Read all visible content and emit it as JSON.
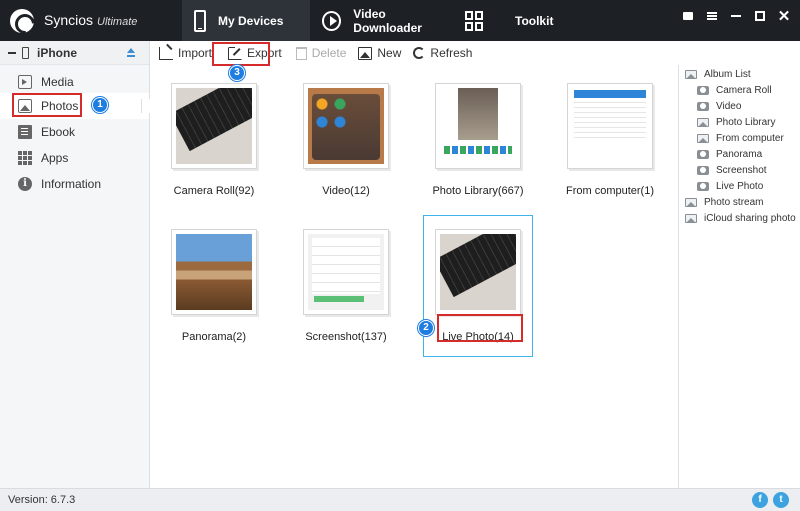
{
  "app": {
    "name": "Syncios",
    "edition": "Ultimate"
  },
  "tabs": {
    "devices": "My Devices",
    "video": "Video Downloader",
    "toolkit": "Toolkit"
  },
  "device": {
    "name": "iPhone"
  },
  "sidebar": {
    "items": [
      {
        "label": "Media",
        "icon": "media-icon"
      },
      {
        "label": "Photos",
        "icon": "photos-icon"
      },
      {
        "label": "Ebook",
        "icon": "ebook-icon"
      },
      {
        "label": "Apps",
        "icon": "apps-icon"
      },
      {
        "label": "Information",
        "icon": "info-icon"
      }
    ]
  },
  "toolbar": {
    "import": "Import",
    "export": "Export",
    "delete": "Delete",
    "new": "New",
    "refresh": "Refresh"
  },
  "albums": [
    {
      "label": "Camera Roll(92)"
    },
    {
      "label": "Video(12)"
    },
    {
      "label": "Photo Library(667)"
    },
    {
      "label": "From computer(1)"
    },
    {
      "label": "Panorama(2)"
    },
    {
      "label": "Screenshot(137)"
    },
    {
      "label": "Live Photo(14)"
    }
  ],
  "album_list": {
    "header": "Album List",
    "items": [
      "Camera Roll",
      "Video",
      "Photo Library",
      "From computer",
      "Panorama",
      "Screenshot",
      "Live Photo"
    ],
    "photo_stream": "Photo stream",
    "icloud": "iCloud sharing photo"
  },
  "annotations": {
    "step1": "1",
    "step2": "2",
    "step3": "3"
  },
  "status": {
    "version": "Version: 6.7.3"
  },
  "social": {
    "facebook": "f",
    "twitter": "t"
  },
  "info_glyph": "i",
  "colors": {
    "titlebar": "#1d2025",
    "highlight": "#d52b2b",
    "badge": "#1e7de0",
    "selection": "#3fb3e8"
  }
}
